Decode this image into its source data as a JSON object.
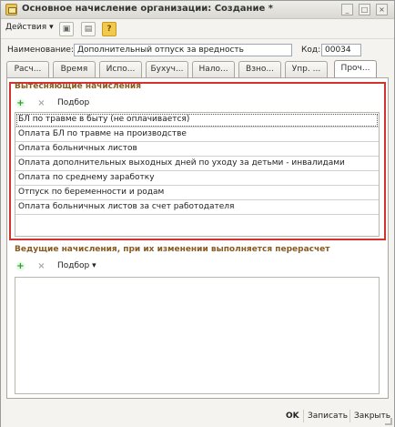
{
  "window": {
    "title": "Основное начисление организации: Создание *",
    "controls": [
      "_",
      "□",
      "×"
    ]
  },
  "toolbar": {
    "actions": "Действия",
    "icons": [
      "save-icon",
      "print-icon",
      "help-icon"
    ]
  },
  "form": {
    "name_label": "Наименование:",
    "name_value": "Дополнительный отпуск за вредность",
    "code_label": "Код:",
    "code_value": "00034"
  },
  "tabs": [
    "Расч...",
    "Время",
    "Испо...",
    "Бухуч...",
    "Нало...",
    "Взно...",
    "Упр. ...",
    "Проч..."
  ],
  "displacing": {
    "title": "Вытесняющие начисления",
    "select_label": "Подбор",
    "items": [
      "БЛ по травме в быту (не оплачивается)",
      "Оплата БЛ по травме на производстве",
      "Оплата больничных листов",
      "Оплата дополнительных выходных дней по уходу за детьми - инвалидами",
      "Оплата по среднему заработку",
      "Отпуск по беременности и родам",
      "Оплата больничных листов за счет работодателя"
    ]
  },
  "leading": {
    "title": "Ведущие начисления, при их изменении выполняется перерасчет",
    "select_label": "Подбор"
  },
  "footer": {
    "ok": "OK",
    "save": "Записать",
    "close": "Закрыть"
  }
}
